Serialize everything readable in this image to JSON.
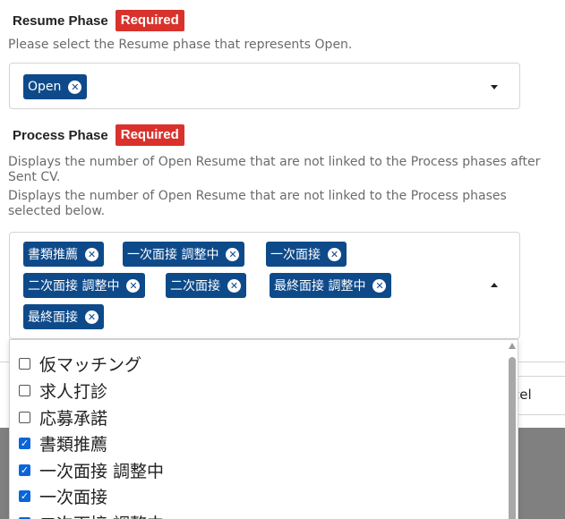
{
  "resume_phase": {
    "label": "Resume Phase",
    "required_badge": "Required",
    "help": "Please select the Resume phase that represents Open.",
    "selected": [
      {
        "label": "Open",
        "remove": "⊗"
      }
    ]
  },
  "process_phase": {
    "label": "Process Phase",
    "required_badge": "Required",
    "help_line1": "Displays the number of Open Resume that are not linked to the Process phases after Sent CV.",
    "help_line2": "Displays the number of Open Resume that are not linked to the Process phases selected below.",
    "selected": [
      {
        "label": "書類推薦"
      },
      {
        "label": "一次面接 調整中"
      },
      {
        "label": "一次面接"
      },
      {
        "label": "二次面接 調整中"
      },
      {
        "label": "二次面接"
      },
      {
        "label": "最終面接 調整中"
      },
      {
        "label": "最終面接"
      }
    ],
    "options": [
      {
        "label": "仮マッチング",
        "checked": false
      },
      {
        "label": "求人打診",
        "checked": false
      },
      {
        "label": "応募承諾",
        "checked": false
      },
      {
        "label": "書類推薦",
        "checked": true
      },
      {
        "label": "一次面接 調整中",
        "checked": true
      },
      {
        "label": "一次面接",
        "checked": true
      },
      {
        "label": "二次面接 調整中",
        "checked": true
      }
    ]
  },
  "background_dialog": {
    "cancel_label_fragment": "cel"
  },
  "colors": {
    "chip": "#0e4a8a",
    "badge": "#d9322c",
    "checkbox_checked": "#0a66d8"
  }
}
